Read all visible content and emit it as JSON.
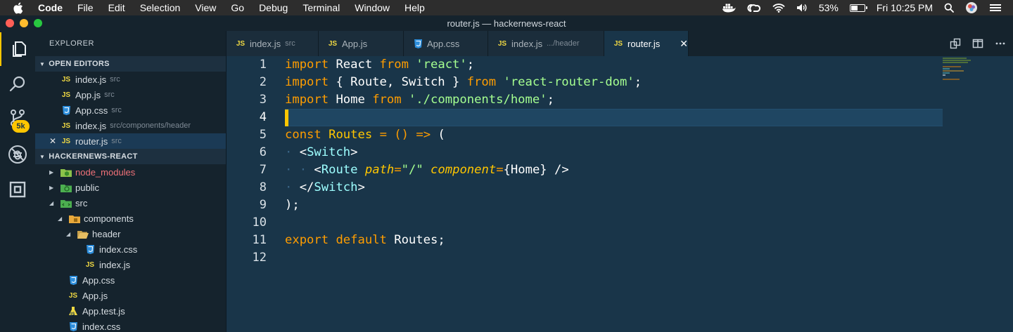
{
  "menubar": {
    "app_name": "Code",
    "items": [
      "File",
      "Edit",
      "Selection",
      "View",
      "Go",
      "Debug",
      "Terminal",
      "Window",
      "Help"
    ],
    "battery_percent": "53%",
    "battery_level": 0.53,
    "clock": "Fri 10:25 PM"
  },
  "window": {
    "title": "router.js — hackernews-react",
    "traffic_lights": [
      "#ff5f57",
      "#febc2e",
      "#28c840"
    ]
  },
  "activity_bar": {
    "items": [
      "explorer-icon",
      "search-icon",
      "source-control-icon",
      "debug-icon",
      "extensions-icon"
    ],
    "scm_badge": "5k",
    "accent": "#ffc600"
  },
  "sidebar": {
    "title": "EXPLORER",
    "open_editors_header": "OPEN EDITORS",
    "open_editors": [
      {
        "name": "index.js",
        "desc": "src",
        "type": "js"
      },
      {
        "name": "App.js",
        "desc": "src",
        "type": "js"
      },
      {
        "name": "App.css",
        "desc": "src",
        "type": "css"
      },
      {
        "name": "index.js",
        "desc": "src/components/header",
        "type": "js"
      },
      {
        "name": "router.js",
        "desc": "src",
        "type": "js",
        "active": true
      }
    ],
    "project_header": "HACKERNEWS-REACT",
    "tree": [
      {
        "name": "node_modules",
        "level": 0,
        "twist": "collapsed",
        "type": "node-folder"
      },
      {
        "name": "public",
        "level": 0,
        "twist": "collapsed",
        "type": "public-folder"
      },
      {
        "name": "src",
        "level": 0,
        "twist": "expanded",
        "type": "src-folder"
      },
      {
        "name": "components",
        "level": 1,
        "twist": "expanded",
        "type": "components-folder"
      },
      {
        "name": "header",
        "level": 2,
        "twist": "expanded",
        "type": "folder"
      },
      {
        "name": "index.css",
        "level": 3,
        "type": "css"
      },
      {
        "name": "index.js",
        "level": 3,
        "type": "js"
      },
      {
        "name": "App.css",
        "level": 1,
        "type": "css"
      },
      {
        "name": "App.js",
        "level": 1,
        "type": "js"
      },
      {
        "name": "App.test.js",
        "level": 1,
        "type": "test"
      },
      {
        "name": "index.css",
        "level": 1,
        "type": "css"
      }
    ]
  },
  "tabs": [
    {
      "name": "index.js",
      "desc": "src",
      "type": "js"
    },
    {
      "name": "App.js",
      "desc": "",
      "type": "js"
    },
    {
      "name": "App.css",
      "desc": "",
      "type": "css"
    },
    {
      "name": "index.js",
      "desc": ".../header",
      "type": "js"
    },
    {
      "name": "router.js",
      "desc": "",
      "type": "js",
      "active": true
    }
  ],
  "editor": {
    "current_line": 4,
    "lines": [
      [
        [
          "kw",
          "import"
        ],
        [
          "t",
          " React "
        ],
        [
          "kw",
          "from"
        ],
        [
          "t",
          " "
        ],
        [
          "str",
          "'react'"
        ],
        [
          "t",
          ";"
        ]
      ],
      [
        [
          "kw",
          "import"
        ],
        [
          "t",
          " { Route, Switch } "
        ],
        [
          "kw",
          "from"
        ],
        [
          "t",
          " "
        ],
        [
          "str",
          "'react-router-dom'"
        ],
        [
          "t",
          ";"
        ]
      ],
      [
        [
          "kw",
          "import"
        ],
        [
          "t",
          " Home "
        ],
        [
          "kw",
          "from"
        ],
        [
          "t",
          " "
        ],
        [
          "str",
          "'./components/home'"
        ],
        [
          "t",
          ";"
        ]
      ],
      [],
      [
        [
          "kw",
          "const"
        ],
        [
          "t",
          " "
        ],
        [
          "attr2",
          "Routes"
        ],
        [
          "t",
          " "
        ],
        [
          "kw",
          "="
        ],
        [
          "t",
          " "
        ],
        [
          "kw",
          "()"
        ],
        [
          "t",
          " "
        ],
        [
          "kw",
          "=>"
        ],
        [
          "t",
          " ("
        ]
      ],
      [
        [
          "ind",
          "· "
        ],
        [
          "t",
          "<"
        ],
        [
          "tag",
          "Switch"
        ],
        [
          "t",
          ">"
        ]
      ],
      [
        [
          "ind",
          "· · "
        ],
        [
          "t",
          "<"
        ],
        [
          "tag",
          "Route"
        ],
        [
          "t",
          " "
        ],
        [
          "attr",
          "path"
        ],
        [
          "kw",
          "="
        ],
        [
          "str",
          "\"/\""
        ],
        [
          "t",
          " "
        ],
        [
          "attr",
          "component"
        ],
        [
          "kw",
          "="
        ],
        [
          "t",
          "{Home} />"
        ]
      ],
      [
        [
          "ind",
          "· "
        ],
        [
          "t",
          "</"
        ],
        [
          "tag",
          "Switch"
        ],
        [
          "t",
          ">"
        ]
      ],
      [
        [
          "t",
          ");"
        ]
      ],
      [],
      [
        [
          "kw",
          "export"
        ],
        [
          "t",
          " "
        ],
        [
          "kw",
          "default"
        ],
        [
          "t",
          " Routes;"
        ]
      ],
      []
    ]
  }
}
